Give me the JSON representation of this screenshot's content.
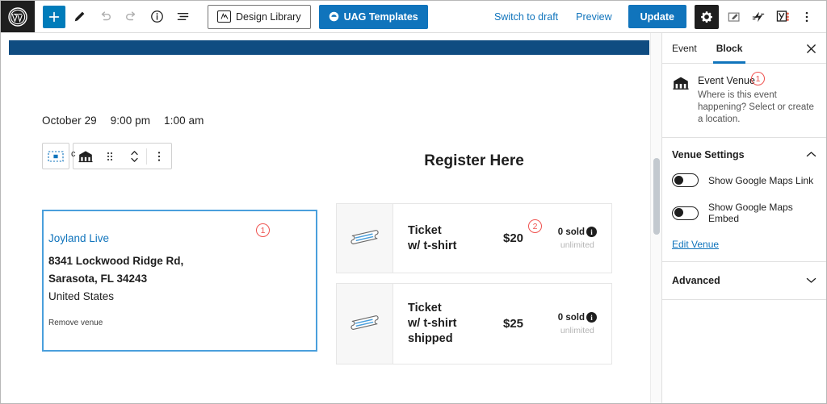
{
  "topbar": {
    "logo_icon": "wordpress-logo-icon",
    "add_block_label": "+",
    "tools": [
      {
        "name": "add-block-button",
        "icon": "plus-icon"
      },
      {
        "name": "edit-tool-button",
        "icon": "pencil-icon"
      },
      {
        "name": "undo-button",
        "icon": "undo-arrow-icon"
      },
      {
        "name": "redo-button",
        "icon": "redo-arrow-icon"
      },
      {
        "name": "details-button",
        "icon": "info-circle-icon"
      },
      {
        "name": "list-view-button",
        "icon": "list-view-icon"
      }
    ],
    "design_library_label": "Design Library",
    "uag_templates_label": "UAG Templates",
    "switch_to_draft_label": "Switch to draft",
    "preview_label": "Preview",
    "update_label": "Update",
    "settings_icon": "gear-icon",
    "edit_doc_icon": "document-edit-icon",
    "jetpack_icon": "jetpack-icon",
    "yoast_icon": "yoast-seo-icon",
    "more_icon": "vertical-ellipsis-icon"
  },
  "canvas": {
    "date_parts": [
      "October 29",
      "9:00 pm",
      "1:00 am"
    ],
    "block_toolbar": {
      "select_parent_icon": "select-parent-block-icon",
      "block_type_icon": "venue-building-icon",
      "drag_icon": "drag-handle-icon",
      "move_icon": "move-up-down-icon",
      "options_icon": "vertical-ellipsis-icon"
    },
    "venue": {
      "name": "Joyland Live",
      "address_line1": "8341 Lockwood Ridge Rd,",
      "address_line2": "Sarasota, FL 34243",
      "country": "United States",
      "remove_label": "Remove venue",
      "annotation": "1"
    },
    "register": {
      "title": "Register Here",
      "tickets": [
        {
          "name_line1": "Ticket",
          "name_line2": "w/ t-shirt",
          "name_line3": "",
          "price": "$20",
          "sold": "0 sold",
          "capacity": "unlimited",
          "icon": "ticket-icon",
          "annotation": "2"
        },
        {
          "name_line1": "Ticket",
          "name_line2": "w/ t-shirt",
          "name_line3": "shipped",
          "price": "$25",
          "sold": "0 sold",
          "capacity": "unlimited",
          "icon": "ticket-icon",
          "annotation": ""
        }
      ]
    }
  },
  "sidebar": {
    "tabs": [
      {
        "label": "Event",
        "active": false
      },
      {
        "label": "Block",
        "active": true
      }
    ],
    "close_icon": "close-icon",
    "block_title": "Event Venue",
    "block_icon": "venue-building-icon",
    "block_description": "Where is this event happening? Select or create a location.",
    "block_annotation": "1",
    "venue_settings": {
      "title": "Venue Settings",
      "collapse_icon": "chevron-up-icon",
      "toggles": [
        {
          "label": "Show Google Maps Link",
          "on": false
        },
        {
          "label": "Show Google Maps Embed",
          "on": false
        }
      ],
      "edit_link": "Edit Venue"
    },
    "advanced": {
      "title": "Advanced",
      "expand_icon": "chevron-down-icon"
    }
  },
  "colors": {
    "wp_blue": "#1074bc",
    "hero_band": "#0f4c81",
    "block_selected": "#4a9fdc",
    "annotation": "#ef5350"
  }
}
